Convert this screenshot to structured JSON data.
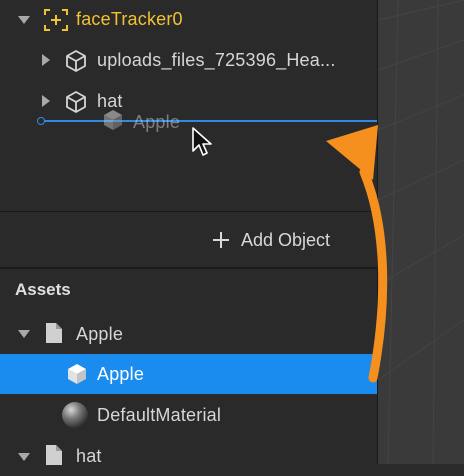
{
  "hierarchy": {
    "items": [
      {
        "label": "faceTracker0",
        "icon": "face-tracker-icon",
        "color": "#f1c232"
      },
      {
        "label": "uploads_files_725396_Hea...",
        "icon": "cube-icon"
      },
      {
        "label": "hat",
        "icon": "cube-icon"
      }
    ],
    "drag_ghost_label": "Apple",
    "add_object_label": "Add Object"
  },
  "assets": {
    "header": "Assets",
    "items": [
      {
        "label": "Apple",
        "icon": "file-icon"
      },
      {
        "label": "Apple",
        "icon": "cube-icon",
        "selected": true
      },
      {
        "label": "DefaultMaterial",
        "icon": "sphere-material-icon"
      },
      {
        "label": "hat",
        "icon": "file-icon"
      }
    ]
  },
  "colors": {
    "selection": "#1a8cf0",
    "drop_indicator": "#2d8be6",
    "annotation_arrow": "#f5901e",
    "tracker": "#f1c232"
  }
}
